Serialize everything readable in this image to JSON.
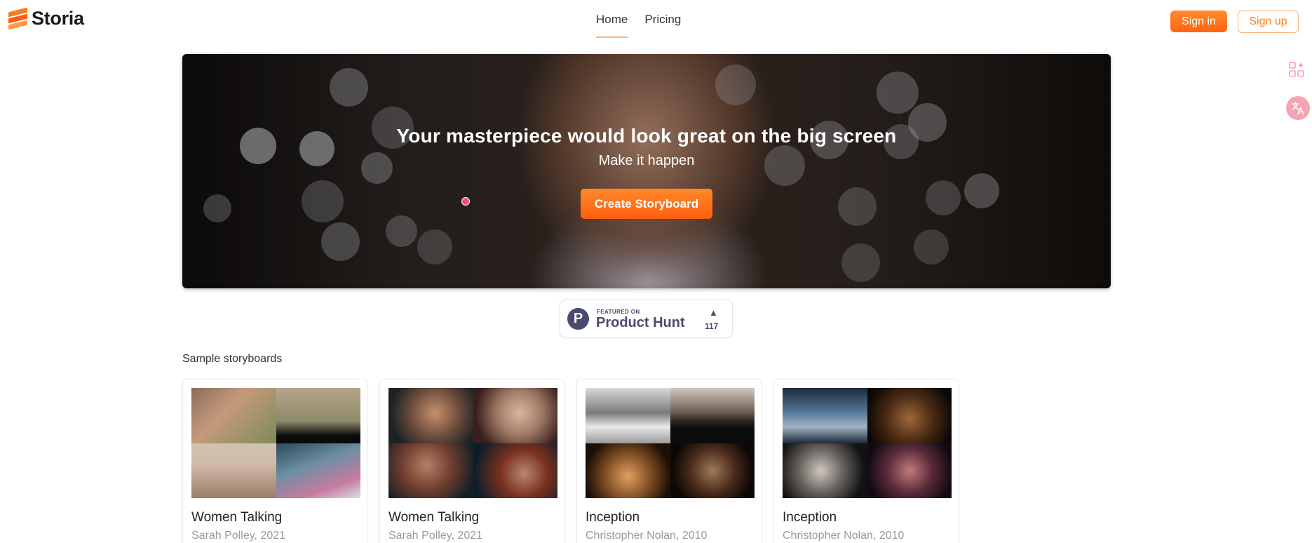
{
  "header": {
    "logo_text": "Storia",
    "nav": [
      {
        "label": "Home",
        "active": true
      },
      {
        "label": "Pricing",
        "active": false
      }
    ],
    "sign_in_label": "Sign in",
    "sign_up_label": "Sign up"
  },
  "side_icons": [
    "apps-sparkle-icon",
    "translate-icon"
  ],
  "hero": {
    "title": "Your masterpiece would look great on the big screen",
    "subtitle": "Make it happen",
    "cta_label": "Create Storyboard"
  },
  "product_hunt": {
    "featured_label": "FEATURED ON",
    "name": "Product Hunt",
    "upvotes": "117"
  },
  "samples": {
    "title": "Sample storyboards",
    "cards": [
      {
        "title": "Women Talking",
        "subtitle": "Sarah Polley, 2021"
      },
      {
        "title": "Women Talking",
        "subtitle": "Sarah Polley, 2021"
      },
      {
        "title": "Inception",
        "subtitle": "Christopher Nolan, 2010"
      },
      {
        "title": "Inception",
        "subtitle": "Christopher Nolan, 2010"
      }
    ]
  },
  "colors": {
    "accent": "#ff7a1a",
    "accent_dark": "#ff5e0e",
    "text": "#222222",
    "muted": "#999999"
  }
}
